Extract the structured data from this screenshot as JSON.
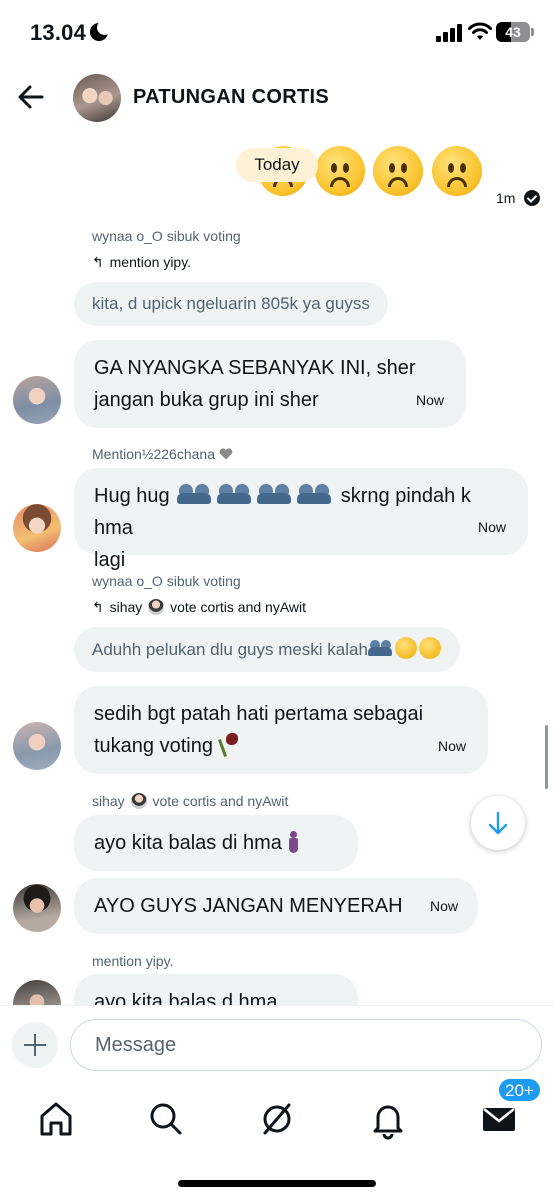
{
  "status_bar": {
    "time": "13.04",
    "battery": "43"
  },
  "header": {
    "title": "PATUNGAN CORTIS"
  },
  "chat": {
    "date_label": "Today",
    "top_time": "1m",
    "messages": [
      {
        "sender": "wynaa o_O sibuk voting",
        "reply_to": "mention yipy.",
        "text": "kita, d upick ngeluarin 805k ya guyss"
      },
      {
        "line1": "GA NYANGKA SEBANYAK INI, sher",
        "line2": "jangan buka grup ini sher",
        "time": "Now"
      },
      {
        "sender": "Mention½226chana",
        "line1_a": "Hug hug",
        "line1_b": "skrng pindah k hma",
        "line2": "lagi",
        "time": "Now"
      },
      {
        "sender": "wynaa o_O sibuk voting",
        "reply_to_a": "sihay",
        "reply_to_b": "vote cortis and nyAwit",
        "text": "Aduhh pelukan dlu guys meski kalah"
      },
      {
        "line1": "sedih bgt patah hati pertama sebagai",
        "line2": "tukang voting",
        "time": "Now"
      },
      {
        "reply_to_a": "sihay",
        "reply_to_b": "vote cortis and nyAwit",
        "text": "ayo kita balas di hma"
      },
      {
        "text": "AYO GUYS JANGAN MENYERAH",
        "time": "Now"
      },
      {
        "sender": "mention yipy.",
        "text": "ayo kita balas d hma"
      }
    ]
  },
  "composer": {
    "placeholder": "Message"
  },
  "nav": {
    "items": [
      "home-icon",
      "search-icon",
      "grok-icon",
      "notifications-icon",
      "messages-icon"
    ],
    "badge": "20+"
  },
  "colors": {
    "accent": "#1d9bf0",
    "bubble": "#eff3f4",
    "muted": "#536471"
  }
}
